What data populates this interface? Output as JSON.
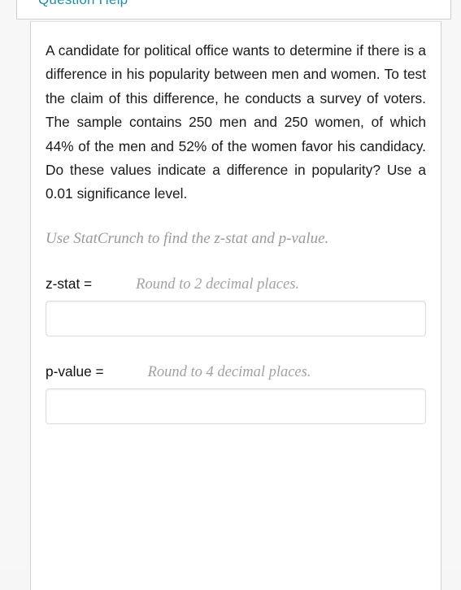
{
  "top_panel": {
    "clipped_text": "Question  Help",
    "accent_color": "#1e8fa8"
  },
  "question": {
    "problem_text": "A candidate for political office wants to determine if there is a difference in his popularity between men and women.  To test the claim of this difference, he conducts a survey of voters.  The sample contains 250 men and 250 women, of which 44% of the men and 52% of the women favor his candidacy.  Do these values indicate a difference in popularity?  Use a 0.01 significance level.",
    "hint": "Use StatCrunch to find the z-stat and p-value."
  },
  "answers": {
    "z_stat": {
      "label": "z-stat =",
      "note": "Round to 2 decimal places.",
      "value": "",
      "placeholder": ""
    },
    "p_value": {
      "label": "p-value =",
      "note": "Round to 4 decimal places.",
      "value": "",
      "placeholder": ""
    }
  },
  "colors": {
    "page_background": "#f7f7f7",
    "card_background": "#ffffff",
    "body_text": "#1a1a1a",
    "muted_text": "#9a9a9a",
    "input_border": "#dddddd"
  }
}
